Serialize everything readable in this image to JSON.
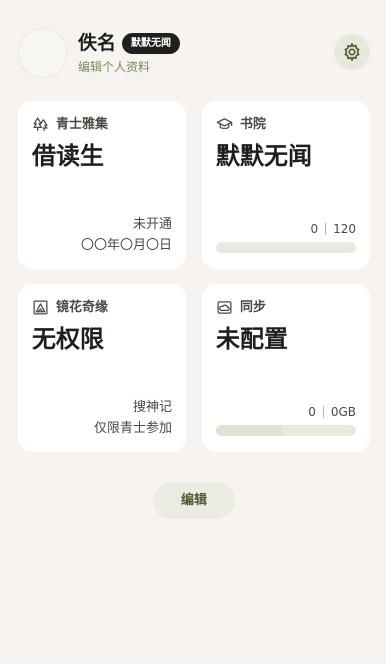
{
  "profile": {
    "name": "佚名",
    "badge": "默默无闻",
    "edit_link": "编辑个人资料"
  },
  "cards": {
    "membership": {
      "label": "青士雅集",
      "title": "借读生",
      "status": "未开通",
      "date": "〇〇年〇月〇日"
    },
    "academy": {
      "label": "书院",
      "title": "默默无闻",
      "progress_current": "0",
      "progress_total": "120",
      "progress_fraction": 0.0
    },
    "mirror": {
      "label": "镜花奇缘",
      "title": "无权限",
      "note1": "搜神记",
      "note2": "仅限青士参加"
    },
    "sync": {
      "label": "同步",
      "title": "未配置",
      "used": "0",
      "capacity": "0GB",
      "progress_fraction": 0.47
    }
  },
  "footer": {
    "edit_button": "编辑"
  },
  "icons": {
    "settings": "gear-icon",
    "membership": "trees-icon",
    "academy": "graduation-cap-icon",
    "mirror": "framed-mountain-icon",
    "sync": "cloud-box-icon"
  },
  "colors": {
    "background": "#f6f3f0",
    "accent": "#4f5b33",
    "badge": "#1f1f1c"
  }
}
